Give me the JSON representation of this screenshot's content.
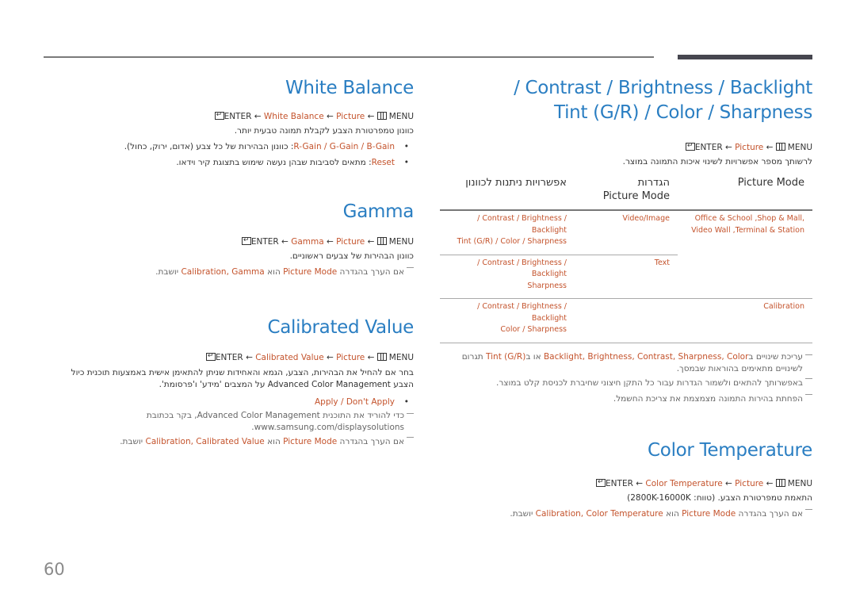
{
  "page_number": "60",
  "icons": {
    "enter": "enter-key-icon",
    "menu": "menu-key-icon"
  },
  "colors": {
    "heading": "#2a7ec2",
    "highlight": "#c4532c",
    "text": "#333333",
    "rule": "#7a7a7a"
  },
  "white_balance": {
    "title": "White Balance",
    "path": {
      "menu": "MENU",
      "arrow": "←",
      "picture": "Picture",
      "item": "White Balance",
      "enter": "ENTER"
    },
    "description": "כוונון טמפרטורת הצבע לקבלת תמונה טבעית יותר.",
    "bullets": [
      {
        "options": "R-Gain / G-Gain / B-Gain",
        "text": ": כוונון הבהירות של כל צבע (אדום, ירוק, כחול)."
      },
      {
        "options": "Reset",
        "text": ": מתאים לסביבות שבהן נעשה שימוש בתצוגת קיר וידאו."
      }
    ]
  },
  "gamma": {
    "title": "Gamma",
    "path": {
      "menu": "MENU",
      "arrow": "←",
      "picture": "Picture",
      "item": "Gamma",
      "enter": "ENTER"
    },
    "description": "כוונון הבהירות של צבעים ראשוניים.",
    "note": {
      "prefix": "אם הערך בהגדרה ",
      "mode": "Picture Mode",
      "mid": " הוא ",
      "value": "Calibration, Gamma",
      "suffix": " יושבת."
    }
  },
  "calibrated_value": {
    "title": "Calibrated Value",
    "path": {
      "menu": "MENU",
      "arrow": "←",
      "picture": "Picture",
      "item": "Calibrated Value",
      "enter": "ENTER"
    },
    "description": "בחר אם להחיל את הבהירות, הצבע, הגמא והאחידות שניתן להתאימן אישית באמצעות תוכנית כיול הצבע Advanced Color Management על המצבים 'מידע' ו'פרסומת'.",
    "bullet": "Apply / Don't Apply",
    "note1": "כדי להוריד את התוכנית Advanced Color Management, בקר בכתובת www.samsung.com/displaysolutions.",
    "note2": {
      "prefix": "אם הערך בהגדרה ",
      "mode": "Picture Mode",
      "mid": " הוא ",
      "value": "Calibration, Calibrated Value",
      "suffix": " יושבת."
    }
  },
  "contrast_section": {
    "title_line1": "/ Contrast / Brightness / Backlight",
    "title_line2": "Tint (G/R) / Color / Sharpness",
    "path": {
      "menu": "MENU",
      "arrow": "←",
      "picture": "Picture",
      "enter": "ENTER"
    },
    "description": "לרשותך מספר אפשרויות לשינוי איכות התמונה במוצר.",
    "table": {
      "headers": [
        "Picture Mode",
        "הגדרות Picture Mode",
        "אפשרויות ניתנות לכוונון"
      ],
      "header2_line1": "הגדרות",
      "header2_line2": "Picture Mode",
      "rows": [
        {
          "mode": "Office & School ,Shop & Mall, Video Wall ,Terminal & Station",
          "mode_line1": "Office & School ,Shop & Mall,",
          "mode_line2": "Video Wall ,Terminal & Station",
          "setting": "Video/Image",
          "options_line1": "/ Contrast / Brightness / Backlight",
          "options_line2": "Tint (G/R) / Color / Sharpness"
        },
        {
          "mode": "",
          "setting": "Text",
          "options_line1": "/ Contrast / Brightness / Backlight",
          "options_line2": "Sharpness"
        },
        {
          "mode": "Calibration",
          "setting": "",
          "options_line1": "/ Contrast / Brightness / Backlight",
          "options_line2": "Color / Sharpness"
        }
      ]
    },
    "notes": [
      {
        "prefix": "עריכת שינויים ב",
        "hl": "Backlight, Brightness, Contrast, Sharpness, Color",
        "mid": " או ב",
        "hl2": "Tint (G/R)",
        "suffix": " תגרום לשינויים מתאימים בהוראות שבמסך."
      },
      {
        "text": "באפשרותך להתאים ולשמור הגדרות עבור כל התקן חיצוני שחיברת לכניסת קלט במוצר."
      },
      {
        "text": "הפחתת בהירות התמונה מצמצמת את צריכת החשמל."
      }
    ]
  },
  "color_temperature": {
    "title": "Color Temperature",
    "path": {
      "menu": "MENU",
      "arrow": "←",
      "picture": "Picture",
      "item": "Color Temperature",
      "enter": "ENTER"
    },
    "description": "התאמת טמפרטורת הצבע. (טווח: 2800K-16000K)",
    "note": {
      "prefix": "אם הערך בהגדרה ",
      "mode": "Picture Mode",
      "mid": " הוא ",
      "value": "Calibration, Color Temperature",
      "suffix": " יושבת."
    }
  }
}
